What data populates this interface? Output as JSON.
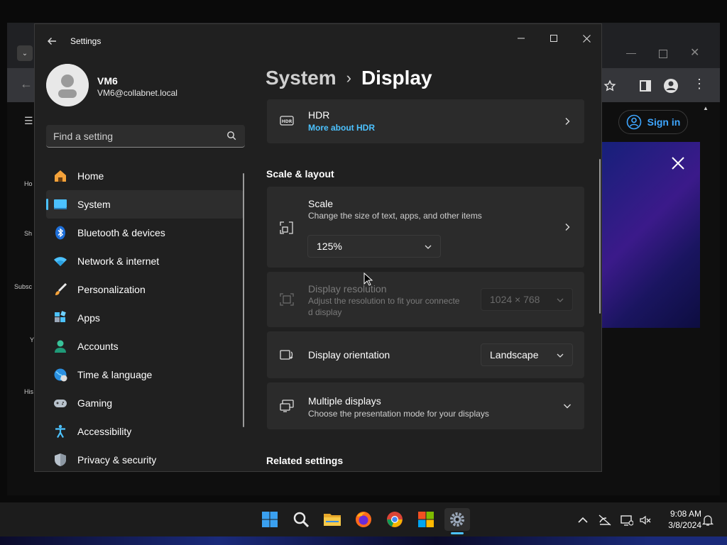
{
  "background_app": {
    "sign_in_label": "Sign in",
    "left_nav": [
      "Ho",
      "Sh",
      "Subsc",
      "Y",
      "His"
    ]
  },
  "window": {
    "title": "Settings",
    "controls": [
      "minimize",
      "maximize",
      "close"
    ]
  },
  "user": {
    "name": "VM6",
    "email": "VM6@collabnet.local"
  },
  "search": {
    "placeholder": "Find a setting"
  },
  "nav": {
    "items": [
      {
        "label": "Home",
        "icon": "home-icon"
      },
      {
        "label": "System",
        "icon": "system-icon",
        "selected": true
      },
      {
        "label": "Bluetooth & devices",
        "icon": "bluetooth-icon"
      },
      {
        "label": "Network & internet",
        "icon": "wifi-icon"
      },
      {
        "label": "Personalization",
        "icon": "brush-icon"
      },
      {
        "label": "Apps",
        "icon": "apps-icon"
      },
      {
        "label": "Accounts",
        "icon": "accounts-icon"
      },
      {
        "label": "Time & language",
        "icon": "globe-icon"
      },
      {
        "label": "Gaming",
        "icon": "gamepad-icon"
      },
      {
        "label": "Accessibility",
        "icon": "accessibility-icon"
      },
      {
        "label": "Privacy & security",
        "icon": "shield-icon"
      }
    ]
  },
  "breadcrumb": {
    "parent": "System",
    "separator": "›",
    "current": "Display"
  },
  "hdr": {
    "title": "HDR",
    "link": "More about HDR"
  },
  "scale_layout": {
    "heading": "Scale & layout",
    "scale": {
      "title": "Scale",
      "subtitle": "Change the size of text, apps, and other items",
      "value": "125%"
    },
    "resolution": {
      "title": "Display resolution",
      "subtitle_line1": "Adjust the resolution to fit your connecte",
      "subtitle_line2": "d display",
      "value": "1024 × 768",
      "disabled": true
    },
    "orientation": {
      "title": "Display orientation",
      "value": "Landscape"
    },
    "multiple": {
      "title": "Multiple displays",
      "subtitle": "Choose the presentation mode for your displays"
    }
  },
  "related": {
    "heading": "Related settings"
  },
  "taskbar": {
    "apps": [
      "start-icon",
      "search-icon",
      "file-explorer-icon",
      "firefox-icon",
      "chrome-icon",
      "store-icon",
      "settings-icon"
    ],
    "time": "9:08 AM",
    "date": "3/8/2024"
  },
  "colors": {
    "accent": "#4cc2ff",
    "window_bg": "#202020",
    "card_bg": "#2b2b2b",
    "link": "#4cc2ff"
  }
}
